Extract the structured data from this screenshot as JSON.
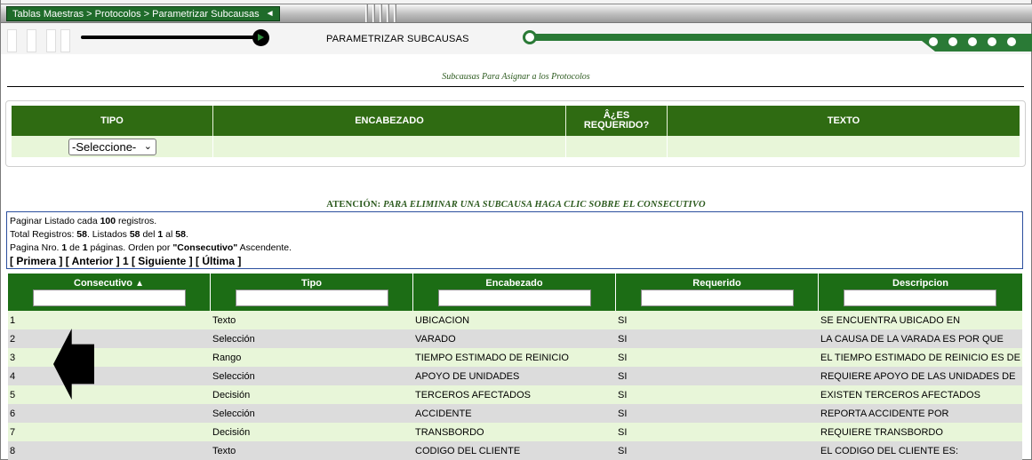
{
  "header": {
    "breadcrumb": "Tablas Maestras > Protocolos > Parametrizar Subcausas",
    "collapse_arrow": "◄",
    "page_title": "PARAMETRIZAR SUBCAUSAS"
  },
  "subtitle": "Subcausas Para Asignar a los Protocolos",
  "form": {
    "columns": [
      "TIPO",
      "ENCABEZADO",
      "Â¿ES\nREQUERIDO?",
      "TEXTO"
    ],
    "col_tipo": "TIPO",
    "col_encabezado": "ENCABEZADO",
    "col_requerido_1": "Â¿ES",
    "col_requerido_2": "REQUERIDO?",
    "col_texto": "TEXTO",
    "tipo_select_value": "-Seleccione-"
  },
  "notice": {
    "prefix": "ATENCIÓN:",
    "text": "PARA ELIMINAR UNA SUBCAUSA HAGA CLIC SOBRE EL CONSECUTIVO"
  },
  "pagination": {
    "line1_a": "Paginar Listado cada ",
    "page_size": "100",
    "line1_b": " registros.",
    "line2_a": "Total Registros: ",
    "total": "58",
    "line2_b": ". Listados ",
    "listed": "58",
    "line2_c": " del ",
    "from": "1",
    "line2_d": " al ",
    "to": "58",
    "line2_e": ".",
    "line3_a": "Pagina Nro. ",
    "page": "1",
    "line3_b": " de ",
    "pages": "1",
    "line3_c": " páginas. Orden por ",
    "order_field": "\"Consecutivo\"",
    "line3_d": " Ascendente.",
    "nav_first": "[ Primera ]",
    "nav_prev": "[ Anterior ]",
    "nav_current": "1",
    "nav_next": "[ Siguiente ]",
    "nav_last": "[ Última ]"
  },
  "table": {
    "headers": {
      "consecutivo": "Consecutivo",
      "sort_icon": "▲",
      "tipo": "Tipo",
      "encabezado": "Encabezado",
      "requerido": "Requerido",
      "descripcion": "Descripcion"
    },
    "rows": [
      {
        "consecutivo": "1",
        "tipo": "Texto",
        "encabezado": "UBICACION",
        "requerido": "SI",
        "descripcion": "SE ENCUENTRA UBICADO EN"
      },
      {
        "consecutivo": "2",
        "tipo": "Selección",
        "encabezado": "VARADO",
        "requerido": "SI",
        "descripcion": "LA CAUSA DE LA VARADA ES POR QUE"
      },
      {
        "consecutivo": "3",
        "tipo": "Rango",
        "encabezado": "TIEMPO ESTIMADO DE REINICIO",
        "requerido": "SI",
        "descripcion": "EL TIEMPO ESTIMADO DE REINICIO ES DE"
      },
      {
        "consecutivo": "4",
        "tipo": "Selección",
        "encabezado": "APOYO DE UNIDADES",
        "requerido": "SI",
        "descripcion": "REQUIERE APOYO DE LAS UNIDADES DE"
      },
      {
        "consecutivo": "5",
        "tipo": "Decisión",
        "encabezado": "TERCEROS AFECTADOS",
        "requerido": "SI",
        "descripcion": "EXISTEN TERCEROS AFECTADOS"
      },
      {
        "consecutivo": "6",
        "tipo": "Selección",
        "encabezado": "ACCIDENTE",
        "requerido": "SI",
        "descripcion": "REPORTA ACCIDENTE POR"
      },
      {
        "consecutivo": "7",
        "tipo": "Decisión",
        "encabezado": "TRANSBORDO",
        "requerido": "SI",
        "descripcion": "REQUIERE TRANSBORDO"
      },
      {
        "consecutivo": "8",
        "tipo": "Texto",
        "encabezado": "CODIGO DEL CLIENTE",
        "requerido": "SI",
        "descripcion": "EL CODIGO DEL CLIENTE ES:"
      }
    ]
  },
  "colors": {
    "brand_green": "#1c6d15",
    "row_light": "#e8f6d9",
    "row_gray": "#dcdcdc"
  }
}
